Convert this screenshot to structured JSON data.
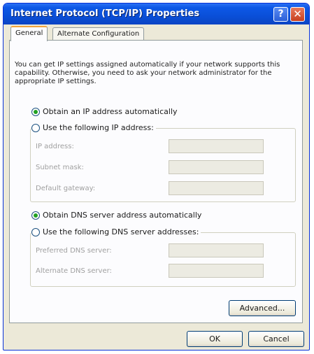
{
  "window": {
    "title": "Internet Protocol (TCP/IP) Properties",
    "help_glyph": "?",
    "close_glyph": "✕"
  },
  "tabs": [
    {
      "label": "General",
      "active": true
    },
    {
      "label": "Alternate Configuration",
      "active": false
    }
  ],
  "description": "You can get IP settings assigned automatically if your network supports this capability. Otherwise, you need to ask your network administrator for the appropriate IP settings.",
  "ip_section": {
    "auto_label": "Obtain an IP address automatically",
    "manual_label": "Use the following IP address:",
    "selected": "auto",
    "fields": [
      {
        "label": "IP address:",
        "value": ""
      },
      {
        "label": "Subnet mask:",
        "value": ""
      },
      {
        "label": "Default gateway:",
        "value": ""
      }
    ]
  },
  "dns_section": {
    "auto_label": "Obtain DNS server address automatically",
    "manual_label": "Use the following DNS server addresses:",
    "selected": "auto",
    "fields": [
      {
        "label": "Preferred DNS server:",
        "value": ""
      },
      {
        "label": "Alternate DNS server:",
        "value": ""
      }
    ]
  },
  "buttons": {
    "advanced": "Advanced...",
    "ok": "OK",
    "cancel": "Cancel"
  },
  "colors": {
    "titlebar": "#0a4fd8",
    "dialog_bg": "#ece9d8",
    "radio_dot": "#21a121",
    "close_button": "#c73f1f"
  }
}
